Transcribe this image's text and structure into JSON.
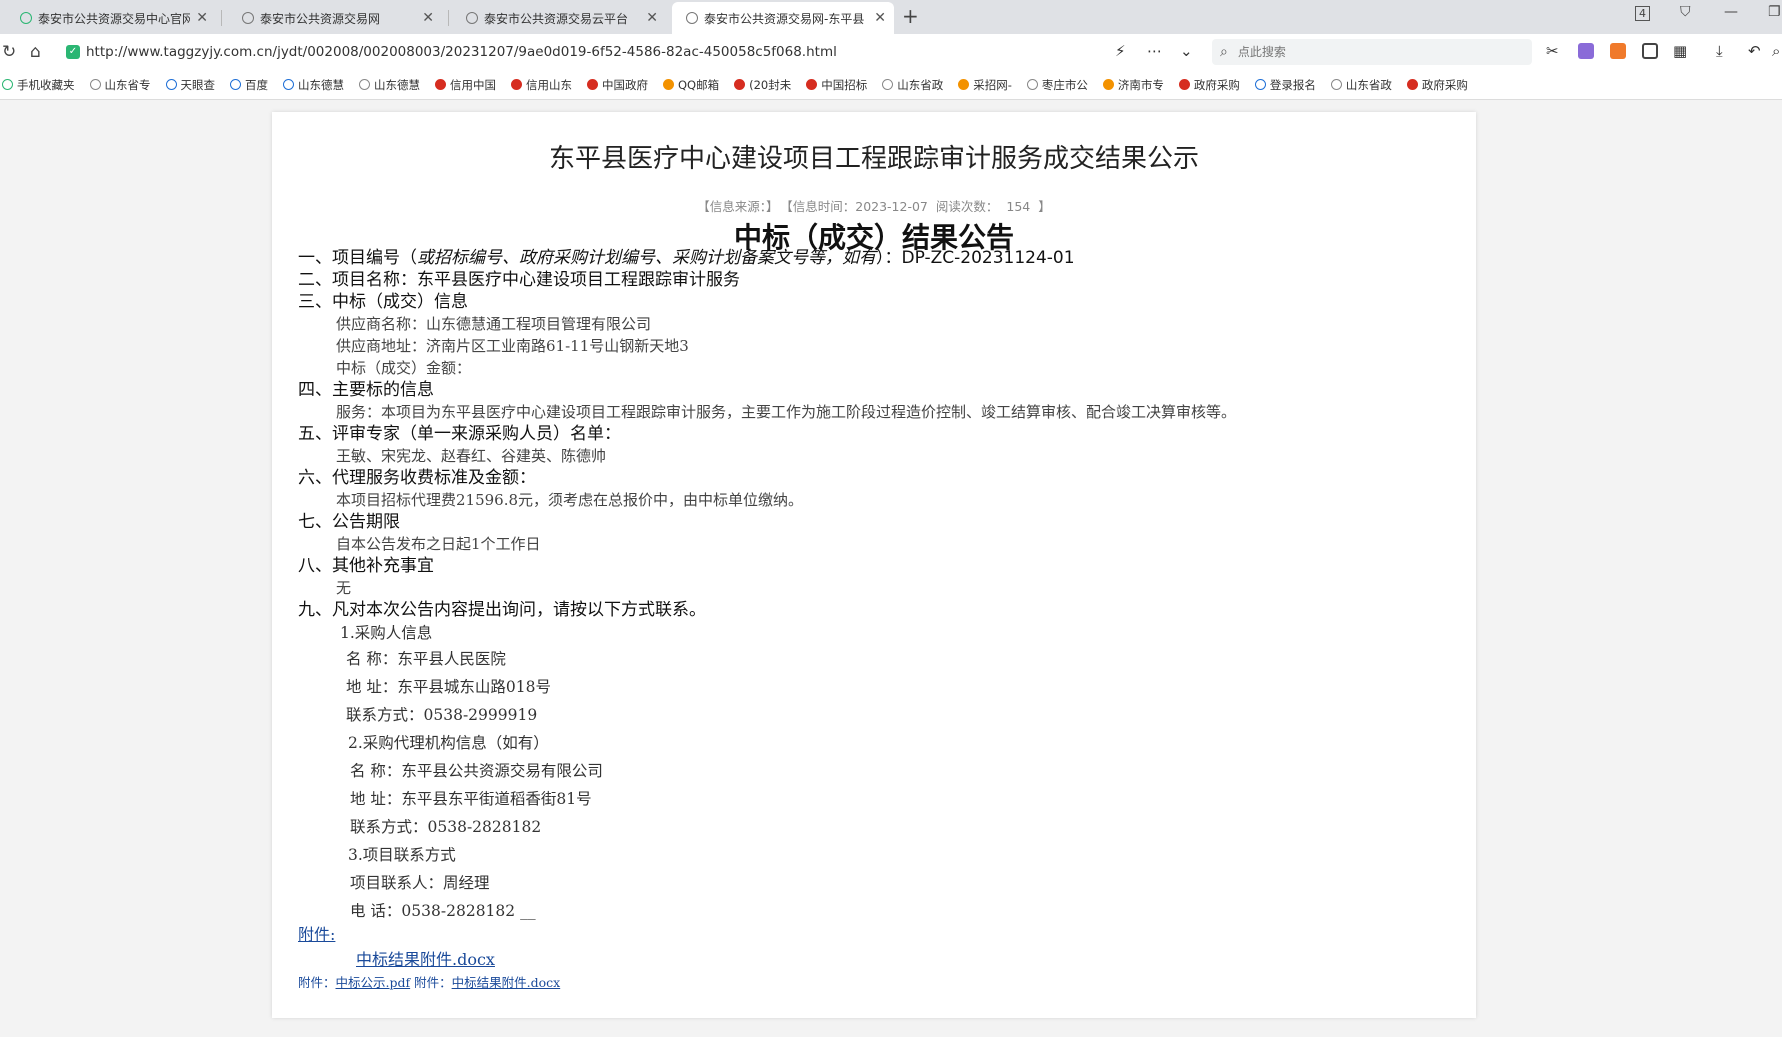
{
  "tabs": [
    {
      "title": "泰安市公共资源交易中心官网_"
    },
    {
      "title": "泰安市公共资源交易网"
    },
    {
      "title": "泰安市公共资源交易云平台"
    },
    {
      "title": "泰安市公共资源交易网-东平县"
    }
  ],
  "window": {
    "badge": "4"
  },
  "address": {
    "url": "http://www.taggzyjy.com.cn/jydt/002008/002008003/20231207/9ae0d019-6f52-4586-82ac-450058c5f068.html",
    "search_placeholder": "点此搜索"
  },
  "bookmarks": [
    "手机收藏夹",
    "山东省专",
    "天眼查",
    "百度",
    "山东德慧",
    "山东德慧",
    "信用中国",
    "信用山东",
    "中国政府",
    "QQ邮箱",
    "(20封未",
    "中国招标",
    "山东省政",
    "采招网-",
    "枣庄市公",
    "济南市专",
    "政府采购",
    "登录报名",
    "山东省政",
    "政府采购"
  ],
  "article": {
    "title": "东平县医疗中心建设项目工程跟踪审计服务成交结果公示",
    "meta_source": "【信息来源：】",
    "meta_time": "【信息时间：2023-12-07",
    "meta_reads": "阅读次数：",
    "meta_count": "154",
    "meta_end": "】",
    "heading": "中标（成交）结果公告",
    "s1_prefix": "一、项目编号（",
    "s1_italic": "或招标编号、政府采购计划编号、采购计划备案文号等，如有",
    "s1_suffix": "）：DP-ZC-20231124-01",
    "s2": "二、项目名称：东平县医疗中心建设项目工程跟踪审计服务",
    "s3": "三、中标（成交）信息",
    "s3_supplier": "供应商名称：山东德慧通工程项目管理有限公司",
    "s3_address": "供应商地址：济南片区工业南路61-11号山钢新天地3",
    "s3_amount": "中标（成交）金额：",
    "s4": "四、主要标的信息",
    "s4_detail": "服务：本项目为东平县医疗中心建设项目工程跟踪审计服务，主要工作为施工阶段过程造价控制、竣工结算审核、配合竣工决算审核等。",
    "s5": "五、评审专家（单一来源采购人员）名单：",
    "s5_names": "王敏、宋宪龙、赵春红、谷建英、陈德帅",
    "s6": "六、代理服务收费标准及金额：",
    "s6_detail": "本项目招标代理费21596.8元，须考虑在总报价中，由中标单位缴纳。",
    "s7": "七、公告期限",
    "s7_detail": "自本公告发布之日起1个工作日",
    "s8": "八、其他补充事宜",
    "s8_detail": "无",
    "s9": "九、凡对本次公告内容提出询问，请按以下方式联系。",
    "c1_title": "1.采购人信息",
    "c1_name": "名    称：东平县人民医院",
    "c1_addr": "地    址：东平县城东山路018号",
    "c1_tel": "联系方式：0538-2999919",
    "c2_title": "2.采购代理机构信息（如有）",
    "c2_name": "名    称：东平县公共资源交易有限公司",
    "c2_addr": "地    址：东平县东平街道稻香街81号",
    "c2_tel": "联系方式：0538-2828182",
    "c3_title": "3.项目联系方式",
    "c3_person": "项目联系人：周经理",
    "c3_tel": "电    话：0538-2828182   __",
    "attach_label": "附件:",
    "attach_file": "中标结果附件.docx",
    "footer_label1": "附件：",
    "footer_file1": "中标公示.pdf",
    "footer_label2": "附件：",
    "footer_file2": "中标结果附件.docx"
  }
}
